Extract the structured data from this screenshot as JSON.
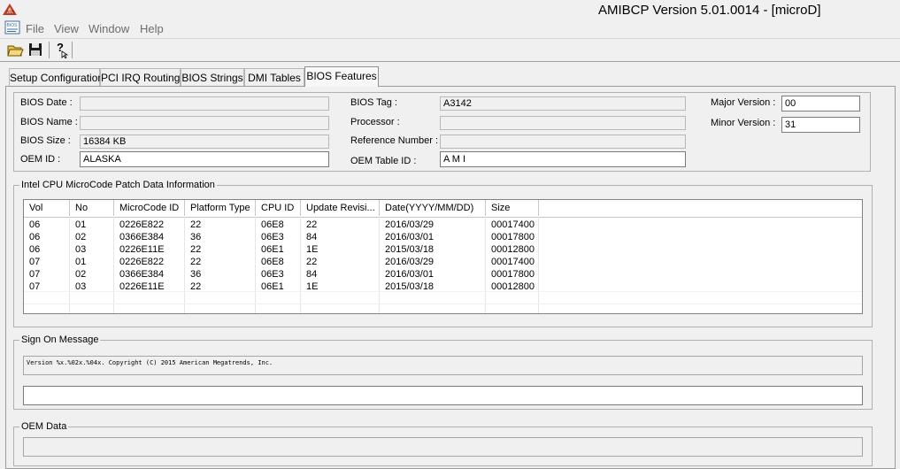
{
  "window": {
    "title": "AMIBCP Version 5.01.0014 - [microD]",
    "icon": "ami-logo-icon"
  },
  "menu": {
    "doc_icon": "ami-document-icon",
    "items": [
      "File",
      "View",
      "Window",
      "Help"
    ]
  },
  "toolbar": {
    "open_icon": "open-folder-icon",
    "save_icon": "save-disk-icon",
    "help_icon": "help-pointer-icon"
  },
  "tabs": [
    "Setup Configuration",
    "PCI IRQ Routing",
    "BIOS Strings",
    "DMI Tables",
    "BIOS Features"
  ],
  "active_tab": "BIOS Features",
  "bios_info": {
    "bios_date": {
      "label": "BIOS Date :",
      "value": ""
    },
    "bios_name": {
      "label": "BIOS Name :",
      "value": ""
    },
    "bios_size": {
      "label": "BIOS Size :",
      "value": "16384 KB"
    },
    "oem_id": {
      "label": "OEM ID :",
      "value": "ALASKA"
    },
    "bios_tag": {
      "label": "BIOS Tag :",
      "value": "A3142"
    },
    "processor": {
      "label": "Processor :",
      "value": ""
    },
    "reference_number": {
      "label": "Reference Number :",
      "value": ""
    },
    "oem_table_id": {
      "label": "OEM Table ID :",
      "value": "A M I"
    },
    "major_version": {
      "label": "Major Version :",
      "value": "00"
    },
    "minor_version": {
      "label": "Minor Version :",
      "value": "31"
    }
  },
  "microcode": {
    "group_title": "Intel CPU MicroCode Patch Data Information",
    "columns": [
      "Vol",
      "No",
      "MicroCode ID",
      "Platform Type",
      "CPU ID",
      "Update Revisi...",
      "Date(YYYY/MM/DD)",
      "Size"
    ],
    "rows": [
      [
        "06",
        "01",
        "0226E822",
        "22",
        "06E8",
        "22",
        "2016/03/29",
        "00017400"
      ],
      [
        "06",
        "02",
        "0366E384",
        "36",
        "06E3",
        "84",
        "2016/03/01",
        "00017800"
      ],
      [
        "06",
        "03",
        "0226E11E",
        "22",
        "06E1",
        "1E",
        "2015/03/18",
        "00012800"
      ],
      [
        "07",
        "01",
        "0226E822",
        "22",
        "06E8",
        "22",
        "2016/03/29",
        "00017400"
      ],
      [
        "07",
        "02",
        "0366E384",
        "36",
        "06E3",
        "84",
        "2016/03/01",
        "00017800"
      ],
      [
        "07",
        "03",
        "0226E11E",
        "22",
        "06E1",
        "1E",
        "2015/03/18",
        "00012800"
      ]
    ]
  },
  "sign_on": {
    "group_title": "Sign On Message",
    "message": "Version %x.%02x.%04x. Copyright (C) 2015 American Megatrends, Inc.",
    "edit_value": ""
  },
  "oem_data": {
    "group_title": "OEM Data",
    "value": ""
  }
}
